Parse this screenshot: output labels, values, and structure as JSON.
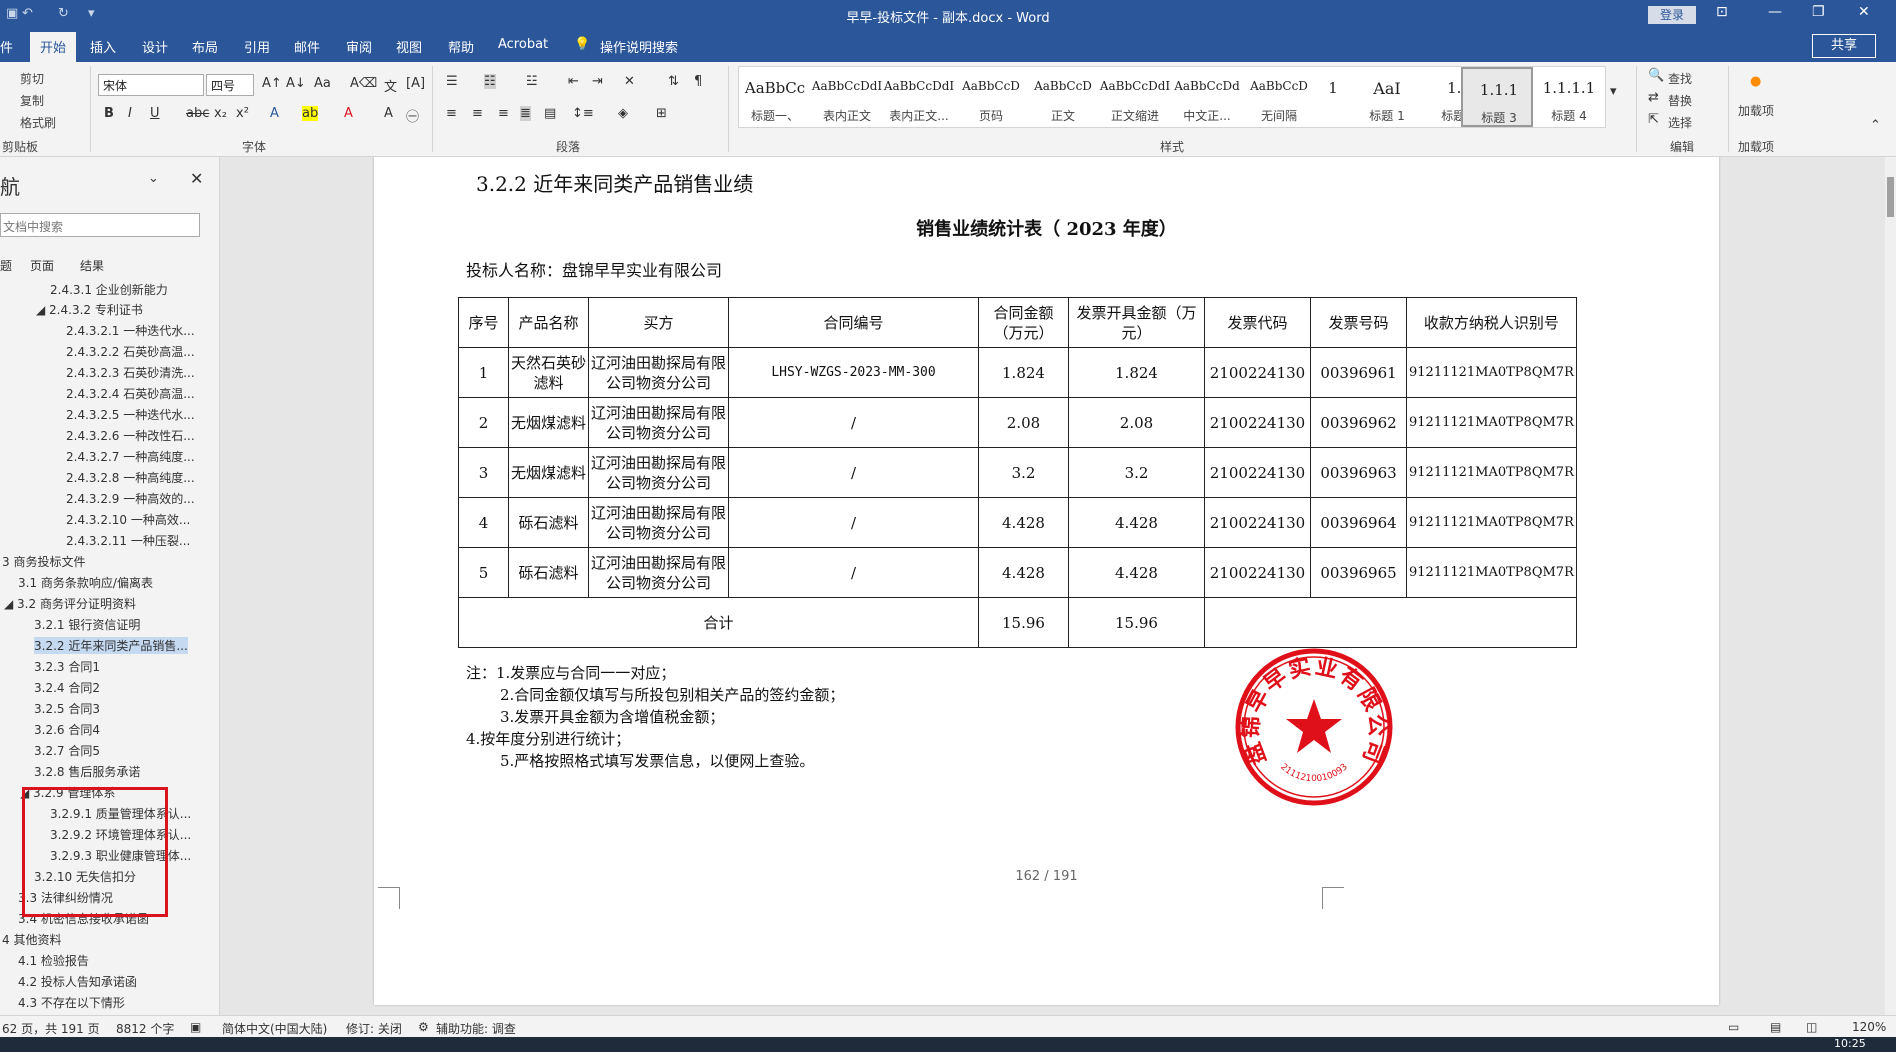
{
  "window": {
    "title": "早早-投标文件 - 副本.docx  -  Word",
    "login": "登录",
    "share": "共享"
  },
  "tabs": [
    "件",
    "开始",
    "插入",
    "设计",
    "布局",
    "引用",
    "邮件",
    "审阅",
    "视图",
    "帮助",
    "Acrobat",
    "操作说明搜索"
  ],
  "ribbon": {
    "clipboard": {
      "cut": "剪切",
      "copy": "复制",
      "format_painter": "格式刷",
      "label": "剪贴板"
    },
    "font": {
      "name": "宋体",
      "size": "四号",
      "label": "字体"
    },
    "paragraph": {
      "label": "段落"
    },
    "styles": {
      "label": "样式",
      "items": [
        {
          "preview": "AaBbCc",
          "name": "标题一、"
        },
        {
          "preview": "AaBbCcDdI",
          "name": "表内正文"
        },
        {
          "preview": "AaBbCcDdI",
          "name": "表内正文..."
        },
        {
          "preview": "AaBbCcD",
          "name": "页码"
        },
        {
          "preview": "AaBbCcD",
          "name": "正文"
        },
        {
          "preview": "AaBbCcDdI",
          "name": "正文缩进"
        },
        {
          "preview": "AaBbCcDd",
          "name": "中文正..."
        },
        {
          "preview": "AaBbCcD",
          "name": "无间隔"
        },
        {
          "preview": "1",
          "name": "标题 1"
        },
        {
          "preview": "AaI",
          "name": "标题 1"
        },
        {
          "preview": "1.1",
          "name": "标题 2"
        },
        {
          "preview": "1.1.1",
          "name": "标题 3"
        },
        {
          "preview": "1.1.1.1",
          "name": "标题 4"
        }
      ]
    },
    "editing": {
      "find": "查找",
      "replace": "替换",
      "select": "选择",
      "label": "编辑"
    },
    "addins": {
      "btn": "加载项",
      "label": "加载项"
    }
  },
  "nav": {
    "title": "航",
    "search_placeholder": "文档中搜索",
    "tabs": [
      "题",
      "页面",
      "结果"
    ],
    "items": [
      "2.4.3.1 企业创新能力",
      "2.4.3.2 专利证书",
      "2.4.3.2.1 一种迭代水...",
      "2.4.3.2.2 石英砂高温...",
      "2.4.3.2.3 石英砂清洗...",
      "2.4.3.2.4 石英砂高温...",
      "2.4.3.2.5 一种迭代水...",
      "2.4.3.2.6 一种改性石...",
      "2.4.3.2.7 一种高纯度...",
      "2.4.3.2.8 一种高纯度...",
      "2.4.3.2.9 一种高效的...",
      "2.4.3.2.10 一种高效...",
      "2.4.3.2.11 一种压裂...",
      "3 商务投标文件",
      "3.1 商务条款响应/偏离表",
      "3.2 商务评分证明资料",
      "3.2.1 银行资信证明",
      "3.2.2 近年来同类产品销售...",
      "3.2.3 合同1",
      "3.2.4 合同2",
      "3.2.5 合同3",
      "3.2.6 合同4",
      "3.2.7 合同5",
      "3.2.8 售后服务承诺",
      "3.2.9 管理体系",
      "3.2.9.1 质量管理体系认...",
      "3.2.9.2 环境管理体系认...",
      "3.2.9.3 职业健康管理体...",
      "3.2.10 无失信扣分",
      "3.3 法律纠纷情况",
      "3.4 机密信息接收承诺函",
      "4 其他资料",
      "4.1 检验报告",
      "4.2 投标人告知承诺函",
      "4.3 不存在以下情形"
    ]
  },
  "document": {
    "heading": "3.2.2  近年来同类产品销售业绩",
    "table_title": "销售业绩统计表（ 2023 年度）",
    "bidder": "投标人名称：盘锦早早实业有限公司",
    "headers": [
      "序号",
      "产品名称",
      "买方",
      "合同编号",
      "合同金额（万元）",
      "发票开具金额（万元）",
      "发票代码",
      "发票号码",
      "收款方纳税人识别号"
    ],
    "rows": [
      [
        "1",
        "天然石英砂滤料",
        "辽河油田勘探局有限公司物资分公司",
        "LHSY-WZGS-2023-MM-300",
        "1.824",
        "1.824",
        "2100224130",
        "00396961",
        "91211121MA0TP8QM7R"
      ],
      [
        "2",
        "无烟煤滤料",
        "辽河油田勘探局有限公司物资分公司",
        "/",
        "2.08",
        "2.08",
        "2100224130",
        "00396962",
        "91211121MA0TP8QM7R"
      ],
      [
        "3",
        "无烟煤滤料",
        "辽河油田勘探局有限公司物资分公司",
        "/",
        "3.2",
        "3.2",
        "2100224130",
        "00396963",
        "91211121MA0TP8QM7R"
      ],
      [
        "4",
        "砾石滤料",
        "辽河油田勘探局有限公司物资分公司",
        "/",
        "4.428",
        "4.428",
        "2100224130",
        "00396964",
        "91211121MA0TP8QM7R"
      ],
      [
        "5",
        "砾石滤料",
        "辽河油田勘探局有限公司物资分公司",
        "/",
        "4.428",
        "4.428",
        "2100224130",
        "00396965",
        "91211121MA0TP8QM7R"
      ]
    ],
    "total_label": "合计",
    "total_contract": "15.96",
    "total_invoice": "15.96",
    "notes": [
      "注：1.发票应与合同一一对应；",
      "2.合同金额仅填写与所投包别相关产品的签约金额；",
      "3.发票开具金额为含增值税金额；",
      "4.按年度分别进行统计；",
      "5.严格按照格式填写发票信息，以便网上查验。"
    ],
    "seal": {
      "company": "盘锦早早实业有限公司",
      "number": "2111210010093",
      "color": "#e0101a"
    },
    "page_number": "162 / 191"
  },
  "status": {
    "page": "62 页，共 191 页",
    "words": "8812 个字",
    "lang": "简体中文(中国大陆)",
    "track": "修订: 关闭",
    "accessibility": "辅助功能: 调查",
    "zoom": "120%"
  },
  "taskbar": {
    "time": "10:25"
  }
}
